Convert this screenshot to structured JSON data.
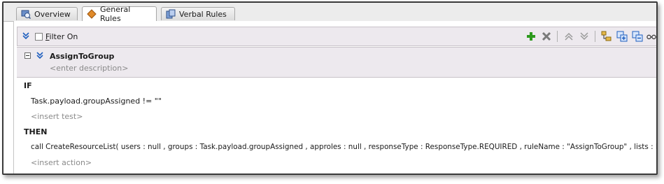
{
  "tabs": [
    {
      "label": "Overview",
      "icon": "overview-icon"
    },
    {
      "label": "General Rules",
      "icon": "rules-diamond-icon",
      "active": true
    },
    {
      "label": "Verbal Rules",
      "icon": "verbal-rules-icon"
    }
  ],
  "toolbar": {
    "filter_label_first": "F",
    "filter_label_rest": "ilter On",
    "filter_checked": false,
    "icons": [
      "add-icon",
      "delete-icon",
      "move-up-icon",
      "move-down-icon",
      "tree-icon",
      "expand-all-icon",
      "collapse-all-icon",
      "glasses-icon"
    ]
  },
  "rule": {
    "name": "AssignToGroup",
    "description_placeholder": "<enter description>",
    "if_keyword": "IF",
    "test": "Task.payload.groupAssigned  !=  \"\"",
    "insert_test": "<insert test>",
    "then_keyword": "THEN",
    "action": "call CreateResourceList( users : null , groups : Task.payload.groupAssigned , approles : null , responseType : ResponseType.REQUIRED , ruleName : \"AssignToGroup\" , lists : Lists )",
    "insert_action": "<insert action>"
  },
  "colors": {
    "add": "#2e9a1e",
    "delete": "#7a7a7a",
    "accent": "#1f5fbf",
    "header_bg": "#ede9ee"
  }
}
